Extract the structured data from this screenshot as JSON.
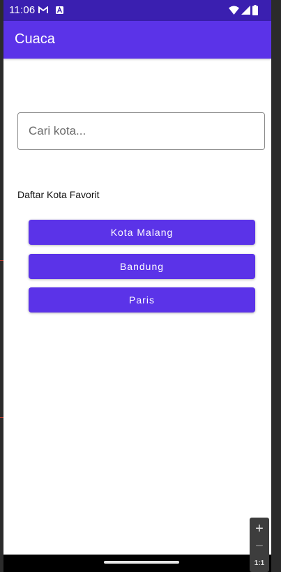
{
  "status_bar": {
    "time": "11:06",
    "icons": [
      "gmail-icon",
      "app-notification-icon",
      "wifi-icon",
      "cell-signal-icon",
      "battery-icon"
    ]
  },
  "app_bar": {
    "title": "Cuaca"
  },
  "search": {
    "placeholder": "Cari kota...",
    "value": ""
  },
  "favorites": {
    "heading": "Daftar Kota Favorit",
    "cities": [
      "Kota Malang",
      "Bandung",
      "Paris"
    ]
  },
  "emulator_zoom": {
    "zoom_in": "+",
    "zoom_out": "−",
    "reset": "1:1"
  },
  "colors": {
    "status_bar": "#3a1fb0",
    "primary": "#5b33e8",
    "on_primary": "#ffffff"
  }
}
